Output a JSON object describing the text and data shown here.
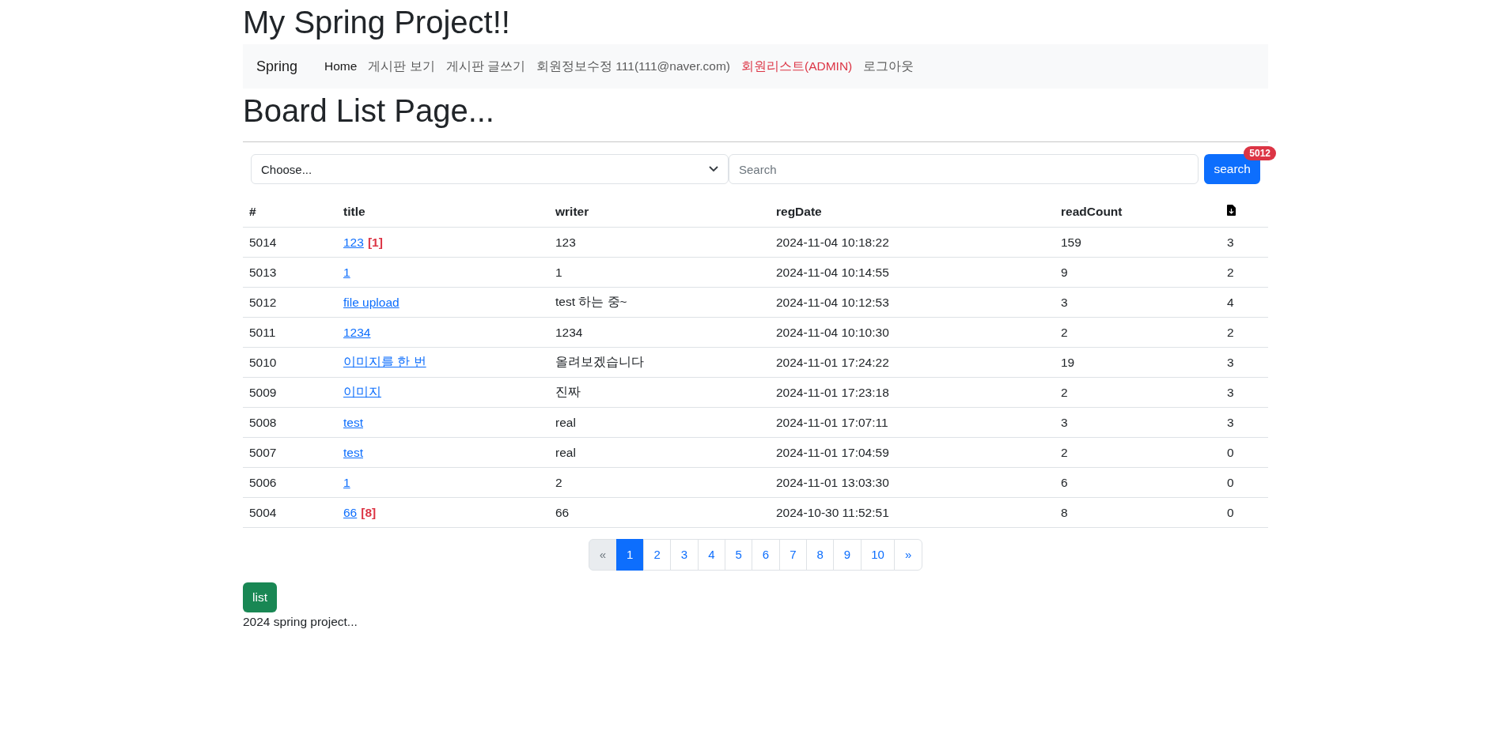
{
  "site_title": "My Spring Project!!",
  "nav": {
    "brand": "Spring",
    "links": [
      {
        "label": "Home",
        "active": true,
        "kind": "default"
      },
      {
        "label": "게시판 보기",
        "active": false,
        "kind": "default"
      },
      {
        "label": "게시판 글쓰기",
        "active": false,
        "kind": "default"
      },
      {
        "label": "회원정보수정 111(111@naver.com)",
        "active": false,
        "kind": "default"
      },
      {
        "label": "회원리스트(ADMIN)",
        "active": false,
        "kind": "danger"
      },
      {
        "label": "로그아웃",
        "active": false,
        "kind": "default"
      }
    ]
  },
  "page_title": "Board List Page...",
  "search": {
    "select_value": "Choose...",
    "placeholder": "Search",
    "button": "search",
    "badge": "5012"
  },
  "table": {
    "columns": [
      "#",
      "title",
      "writer",
      "regDate",
      "readCount"
    ],
    "rows": [
      {
        "no": "5014",
        "title": "123",
        "comments": "[1]",
        "writer": "123",
        "reg_date": "2024-11-04 10:18:22",
        "read_count": "159",
        "files": "3"
      },
      {
        "no": "5013",
        "title": "1",
        "writer": "1",
        "reg_date": "2024-11-04 10:14:55",
        "read_count": "9",
        "files": "2"
      },
      {
        "no": "5012",
        "title": "file upload",
        "writer": "test 하는 중~",
        "reg_date": "2024-11-04 10:12:53",
        "read_count": "3",
        "files": "4"
      },
      {
        "no": "5011",
        "title": "1234",
        "writer": "1234",
        "reg_date": "2024-11-04 10:10:30",
        "read_count": "2",
        "files": "2"
      },
      {
        "no": "5010",
        "title": "이미지를 한 번",
        "writer": "올려보겠습니다",
        "reg_date": "2024-11-01 17:24:22",
        "read_count": "19",
        "files": "3"
      },
      {
        "no": "5009",
        "title": "이미지",
        "writer": "진짜",
        "reg_date": "2024-11-01 17:23:18",
        "read_count": "2",
        "files": "3"
      },
      {
        "no": "5008",
        "title": "test",
        "writer": "real",
        "reg_date": "2024-11-01 17:07:11",
        "read_count": "3",
        "files": "3"
      },
      {
        "no": "5007",
        "title": "test",
        "writer": "real",
        "reg_date": "2024-11-01 17:04:59",
        "read_count": "2",
        "files": "0"
      },
      {
        "no": "5006",
        "title": "1",
        "writer": "2",
        "reg_date": "2024-11-01 13:03:30",
        "read_count": "6",
        "files": "0"
      },
      {
        "no": "5004",
        "title": "66",
        "comments": "[8]",
        "writer": "66",
        "reg_date": "2024-10-30 11:52:51",
        "read_count": "8",
        "files": "0"
      }
    ]
  },
  "pagination": {
    "prev": {
      "label": "«",
      "disabled": true
    },
    "pages": [
      {
        "label": "1",
        "selected": true
      },
      {
        "label": "2",
        "selected": false
      },
      {
        "label": "3",
        "selected": false
      },
      {
        "label": "4",
        "selected": false
      },
      {
        "label": "5",
        "selected": false
      },
      {
        "label": "6",
        "selected": false
      },
      {
        "label": "7",
        "selected": false
      },
      {
        "label": "8",
        "selected": false
      },
      {
        "label": "9",
        "selected": false
      },
      {
        "label": "10",
        "selected": false
      }
    ],
    "next": {
      "label": "»",
      "disabled": false
    }
  },
  "list_button": "list",
  "footer": "2024 spring project..."
}
